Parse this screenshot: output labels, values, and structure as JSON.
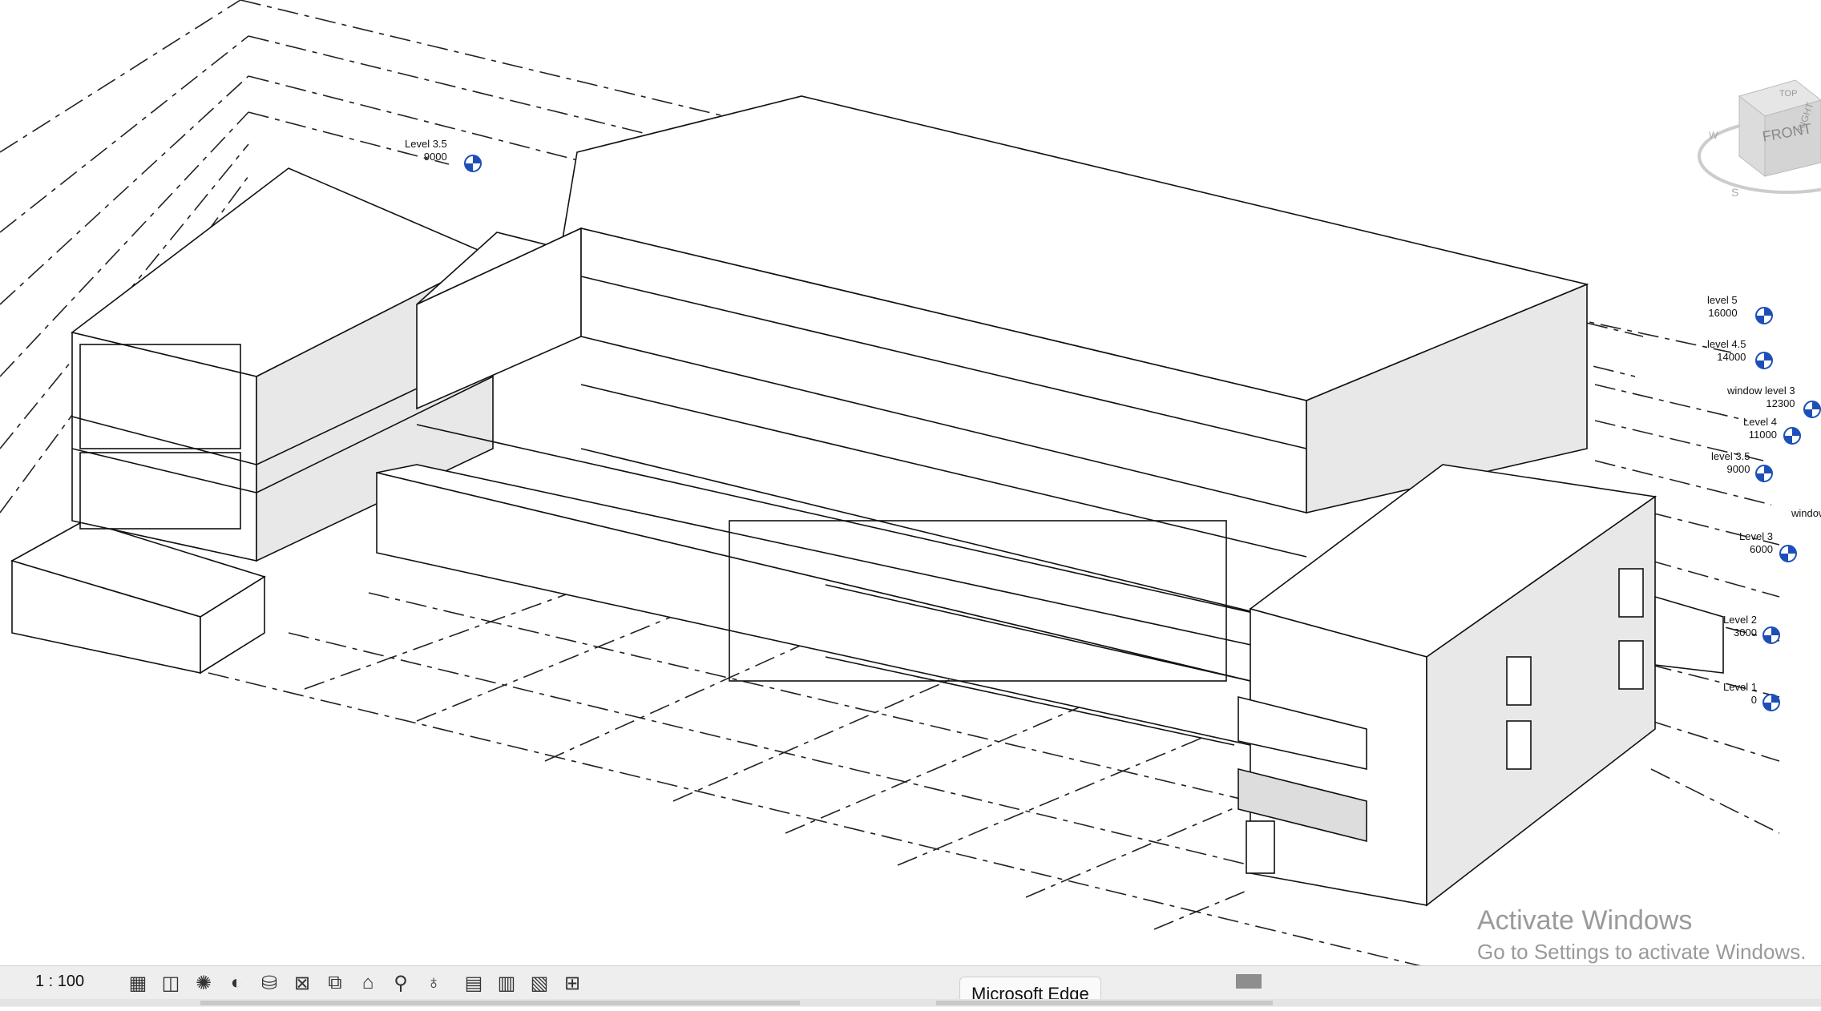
{
  "view": {
    "levels": [
      {
        "name": "Level 3.5",
        "elev": "9000"
      },
      {
        "name": "level 5",
        "elev": "16000"
      },
      {
        "name": "level 4.5",
        "elev": "14000"
      },
      {
        "name": "window level 3",
        "elev": "12300"
      },
      {
        "name": "Level 4",
        "elev": "11000"
      },
      {
        "name": "level 3.5",
        "elev": "9000"
      },
      {
        "name": "window",
        "elev": ""
      },
      {
        "name": "Level 3",
        "elev": "6000"
      },
      {
        "name": "Level 2",
        "elev": "3000"
      },
      {
        "name": "Level 1",
        "elev": "0"
      }
    ],
    "viewcube": {
      "front": "FRONT",
      "top": "TOP",
      "right": "RIGHT",
      "compass_w": "W",
      "compass_s": "S"
    },
    "marker_color": "#1d4fb8"
  },
  "watermark": {
    "line1": "Activate Windows",
    "line2": "Go to Settings to activate Windows."
  },
  "statusbar": {
    "scale": "1 : 100",
    "icons": [
      "detail-level-icon",
      "visual-style-icon",
      "sun-path-icon",
      "shadows-icon",
      "render-icon",
      "crop-view-icon",
      "show-crop-icon",
      "unlock-3d-icon",
      "temporary-hide-icon",
      "reveal-hidden-icon",
      "worksharing-icon",
      "design-options-icon",
      "analytical-model-icon",
      "highlight-displacement-icon"
    ],
    "tooltip": "Microsoft Edge"
  }
}
